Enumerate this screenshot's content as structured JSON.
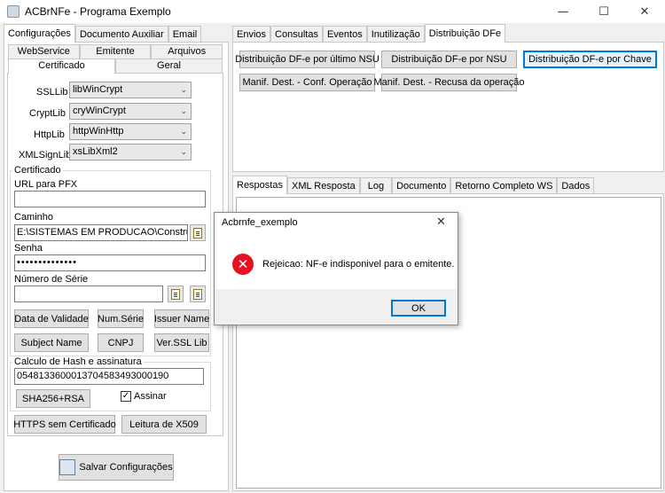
{
  "window": {
    "title": "ACBrNFe - Programa Exemplo",
    "minimize_icon": "—",
    "maximize_icon": "☐",
    "close_icon": "✕"
  },
  "left_tabs": [
    "Configurações",
    "Documento Auxiliar",
    "Email"
  ],
  "left_subtabs_row1": [
    "WebService",
    "Emitente",
    "Arquivos"
  ],
  "left_subtabs_row2": [
    "Certificado",
    "Geral"
  ],
  "cert": {
    "ssllib_label": "SSLLib",
    "ssllib_value": "libWinCrypt",
    "cryptlib_label": "CryptLib",
    "cryptlib_value": "cryWinCrypt",
    "httplib_label": "HttpLib",
    "httplib_value": "httpWinHttp",
    "xmlsign_label": "XMLSignLib",
    "xmlsign_value": "xsLibXml2",
    "group_title": "Certificado",
    "url_label": "URL para PFX",
    "url_value": "",
    "caminho_label": "Caminho",
    "caminho_value": "E:\\SISTEMAS EM PRODUCAO\\Construbel\\CON",
    "senha_label": "Senha",
    "senha_value": "••••••••••••••",
    "serie_label": "Número de Série",
    "serie_value": "",
    "btn_data_validade": "Data de Validade",
    "btn_num_serie": "Num.Série",
    "btn_issuer": "Issuer Name",
    "btn_subject": "Subject Name",
    "btn_cnpj": "CNPJ",
    "btn_ver_ssl": "Ver.SSL Lib",
    "hash_group_title": "Calculo de Hash e assinatura",
    "hash_value": "05481336000137045834930001​90",
    "btn_sha": "SHA256+RSA",
    "assinar_label": "Assinar",
    "assinar_checked": "✓",
    "btn_https": "HTTPS sem Certificado",
    "btn_x509": "Leitura de X509"
  },
  "save_button": "Salvar Configurações",
  "right_tabs": [
    "Envios",
    "Consultas",
    "Eventos",
    "Inutilização",
    "Distribuição DFe"
  ],
  "dfe_buttons": {
    "ultimo_nsu": "Distribuição DF-e por último NSU",
    "por_nsu": "Distribuição DF-e por NSU",
    "por_chave": "Distribuição DF-e por Chave",
    "conf_operacao": "Manif. Dest. - Conf. Operação",
    "recusa": "Manif. Dest. - Recusa da operação"
  },
  "bottom_tabs": [
    "Respostas",
    "XML Resposta",
    "Log",
    "Documento",
    "Retorno Completo WS",
    "Dados"
  ],
  "dialog": {
    "title": "Acbrnfe_exemplo",
    "close_icon": "✕",
    "error_icon": "✕",
    "message": "Rejeicao: NF-e indisponivel para o emitente.",
    "ok_label": "OK"
  }
}
